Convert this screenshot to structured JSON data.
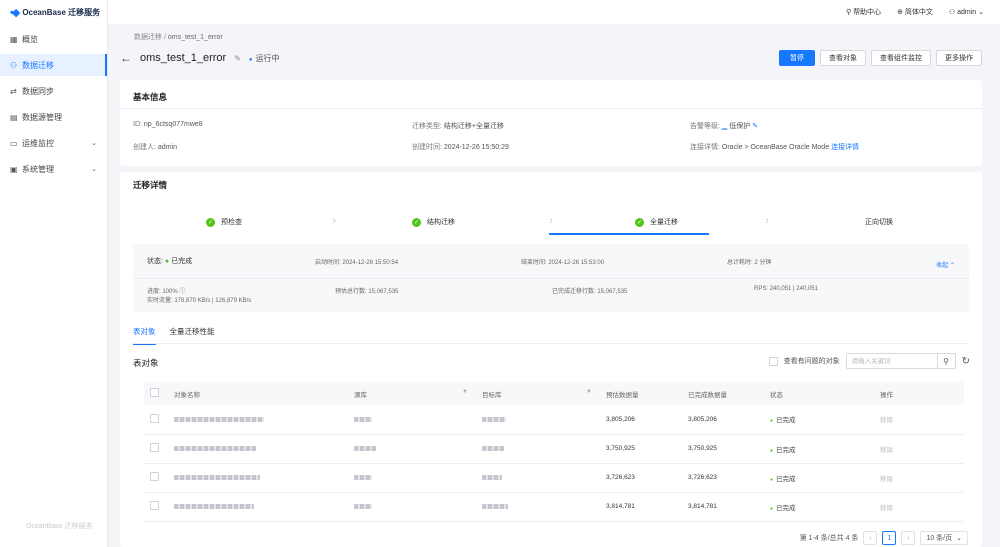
{
  "app": {
    "logo_text": "OceanBase 迁移服务",
    "sidebar_footer": "OceanBase 迁移服务"
  },
  "sidebar": {
    "items": [
      {
        "label": "概览",
        "icon": "grid-icon"
      },
      {
        "label": "数据迁移",
        "icon": "user-icon",
        "active": true
      },
      {
        "label": "数据同步",
        "icon": "sync-icon"
      },
      {
        "label": "数据源管理",
        "icon": "database-icon"
      },
      {
        "label": "运维监控",
        "icon": "monitor-icon",
        "chevron": true
      },
      {
        "label": "系统管理",
        "icon": "settings-icon",
        "chevron": true
      }
    ]
  },
  "topbar": {
    "help": "帮助中心",
    "language": "简体中文",
    "user": "admin"
  },
  "breadcrumb": {
    "parent": "数据迁移",
    "sep": "/",
    "current": "oms_test_1_error"
  },
  "header": {
    "title": "oms_test_1_error",
    "state": "运行中",
    "buttons": [
      "暂停",
      "查看对象",
      "查看组件监控",
      "更多操作"
    ]
  },
  "basic_info": {
    "title": "基本信息",
    "id_label": "ID:",
    "id_value": "np_6ctsq077mwe8",
    "creator_label": "创建人:",
    "creator_value": "admin",
    "type_label": "迁移类型:",
    "type_value": "结构迁移+全量迁移",
    "created_label": "创建时间:",
    "created_value": "2024-12-26 15:50:29",
    "alarm_label": "告警等级:",
    "alarm_value": "低保护",
    "conn_label": "连接详情:",
    "conn_value": "Oracle > OceanBase Oracle Mode",
    "conn_link": "连接详情"
  },
  "migration": {
    "title": "迁移详情",
    "steps": [
      "预检查",
      "结构迁移",
      "全量迁移",
      "正向切换"
    ],
    "status_label": "状态:",
    "status_value": "已完成",
    "start_label": "启动时间:",
    "start_value": "2024-12-26 15:50:54",
    "end_label": "结束时间:",
    "end_value": "2024-12-26 15:53:00",
    "duration_label": "总计耗时:",
    "duration_value": "2 分钟",
    "collapse": "收起",
    "progress_label": "进度:",
    "progress_value": "100%",
    "traffic_label": "实时流量:",
    "traffic_value": "178,870 KB/s | 126,879 KB/s",
    "est_rows_label": "预估总行数:",
    "est_rows_value": "15,067,535",
    "done_rows_label": "已完成迁移行数:",
    "done_rows_value": "15,067,535",
    "rps_label": "RPS:",
    "rps_value": "240,051 | 240,051"
  },
  "tabs": [
    "表对象",
    "全量迁移性能"
  ],
  "table_section": {
    "title": "表对象",
    "problem_only": "查看有问题的对象",
    "search_placeholder": "请输入关键词",
    "columns": [
      "对象名称",
      "源库",
      "目标库",
      "预估数据量",
      "已完成数据量",
      "状态",
      "操作"
    ],
    "rows": [
      {
        "est": "3,805,206",
        "done": "3,805,206",
        "status": "已完成",
        "op": "移除"
      },
      {
        "est": "3,750,925",
        "done": "3,750,925",
        "status": "已完成",
        "op": "移除"
      },
      {
        "est": "3,726,623",
        "done": "3,726,623",
        "status": "已完成",
        "op": "移除"
      },
      {
        "est": "3,814,781",
        "done": "3,814,781",
        "status": "已完成",
        "op": "移除"
      }
    ],
    "pagination": {
      "summary": "第 1-4 条/总共 4 条",
      "current": "1",
      "size": "10 条/页"
    }
  }
}
